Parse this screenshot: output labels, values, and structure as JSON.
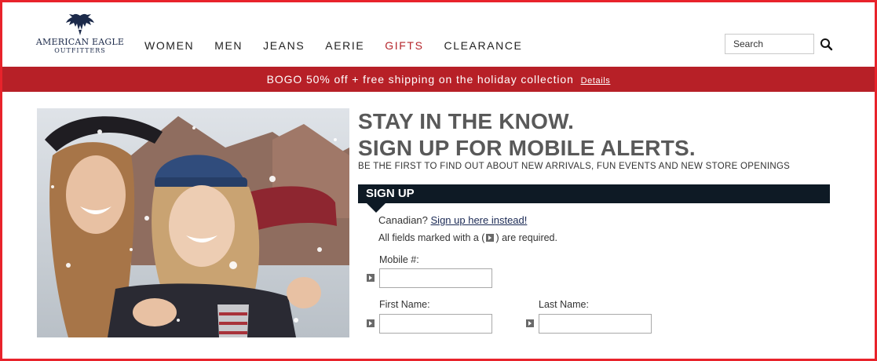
{
  "brand": {
    "line1": "AMERICAN EAGLE",
    "line2": "OUTFITTERS",
    "colors": {
      "navy": "#1c2a4a",
      "red": "#b72027",
      "dark_bar": "#0e1a25"
    }
  },
  "nav": {
    "items": [
      {
        "label": "WOMEN"
      },
      {
        "label": "MEN"
      },
      {
        "label": "JEANS"
      },
      {
        "label": "AERIE"
      },
      {
        "label": "GIFTS"
      },
      {
        "label": "CLEARANCE"
      }
    ]
  },
  "search": {
    "placeholder": "Search",
    "icon": "search-icon"
  },
  "promo": {
    "text": "BOGO 50% off + free shipping on the holiday collection",
    "details_label": "Details"
  },
  "hero": {
    "headline1": "STAY IN THE KNOW.",
    "headline2": "SIGN UP FOR MOBILE ALERTS.",
    "subhead": "BE THE FIRST TO FIND OUT ABOUT NEW ARRIVALS, FUN EVENTS AND NEW STORE OPENINGS"
  },
  "signup": {
    "bar_label": "SIGN UP",
    "canadian_prefix": "Canadian?",
    "canadian_link": "Sign up here instead!",
    "required_prefix": "All fields marked with a (",
    "required_suffix": ") are required.",
    "mobile_label": "Mobile #:",
    "first_name_label": "First Name:",
    "last_name_label": "Last Name:",
    "mobile_value": "",
    "first_name_value": "",
    "last_name_value": ""
  }
}
